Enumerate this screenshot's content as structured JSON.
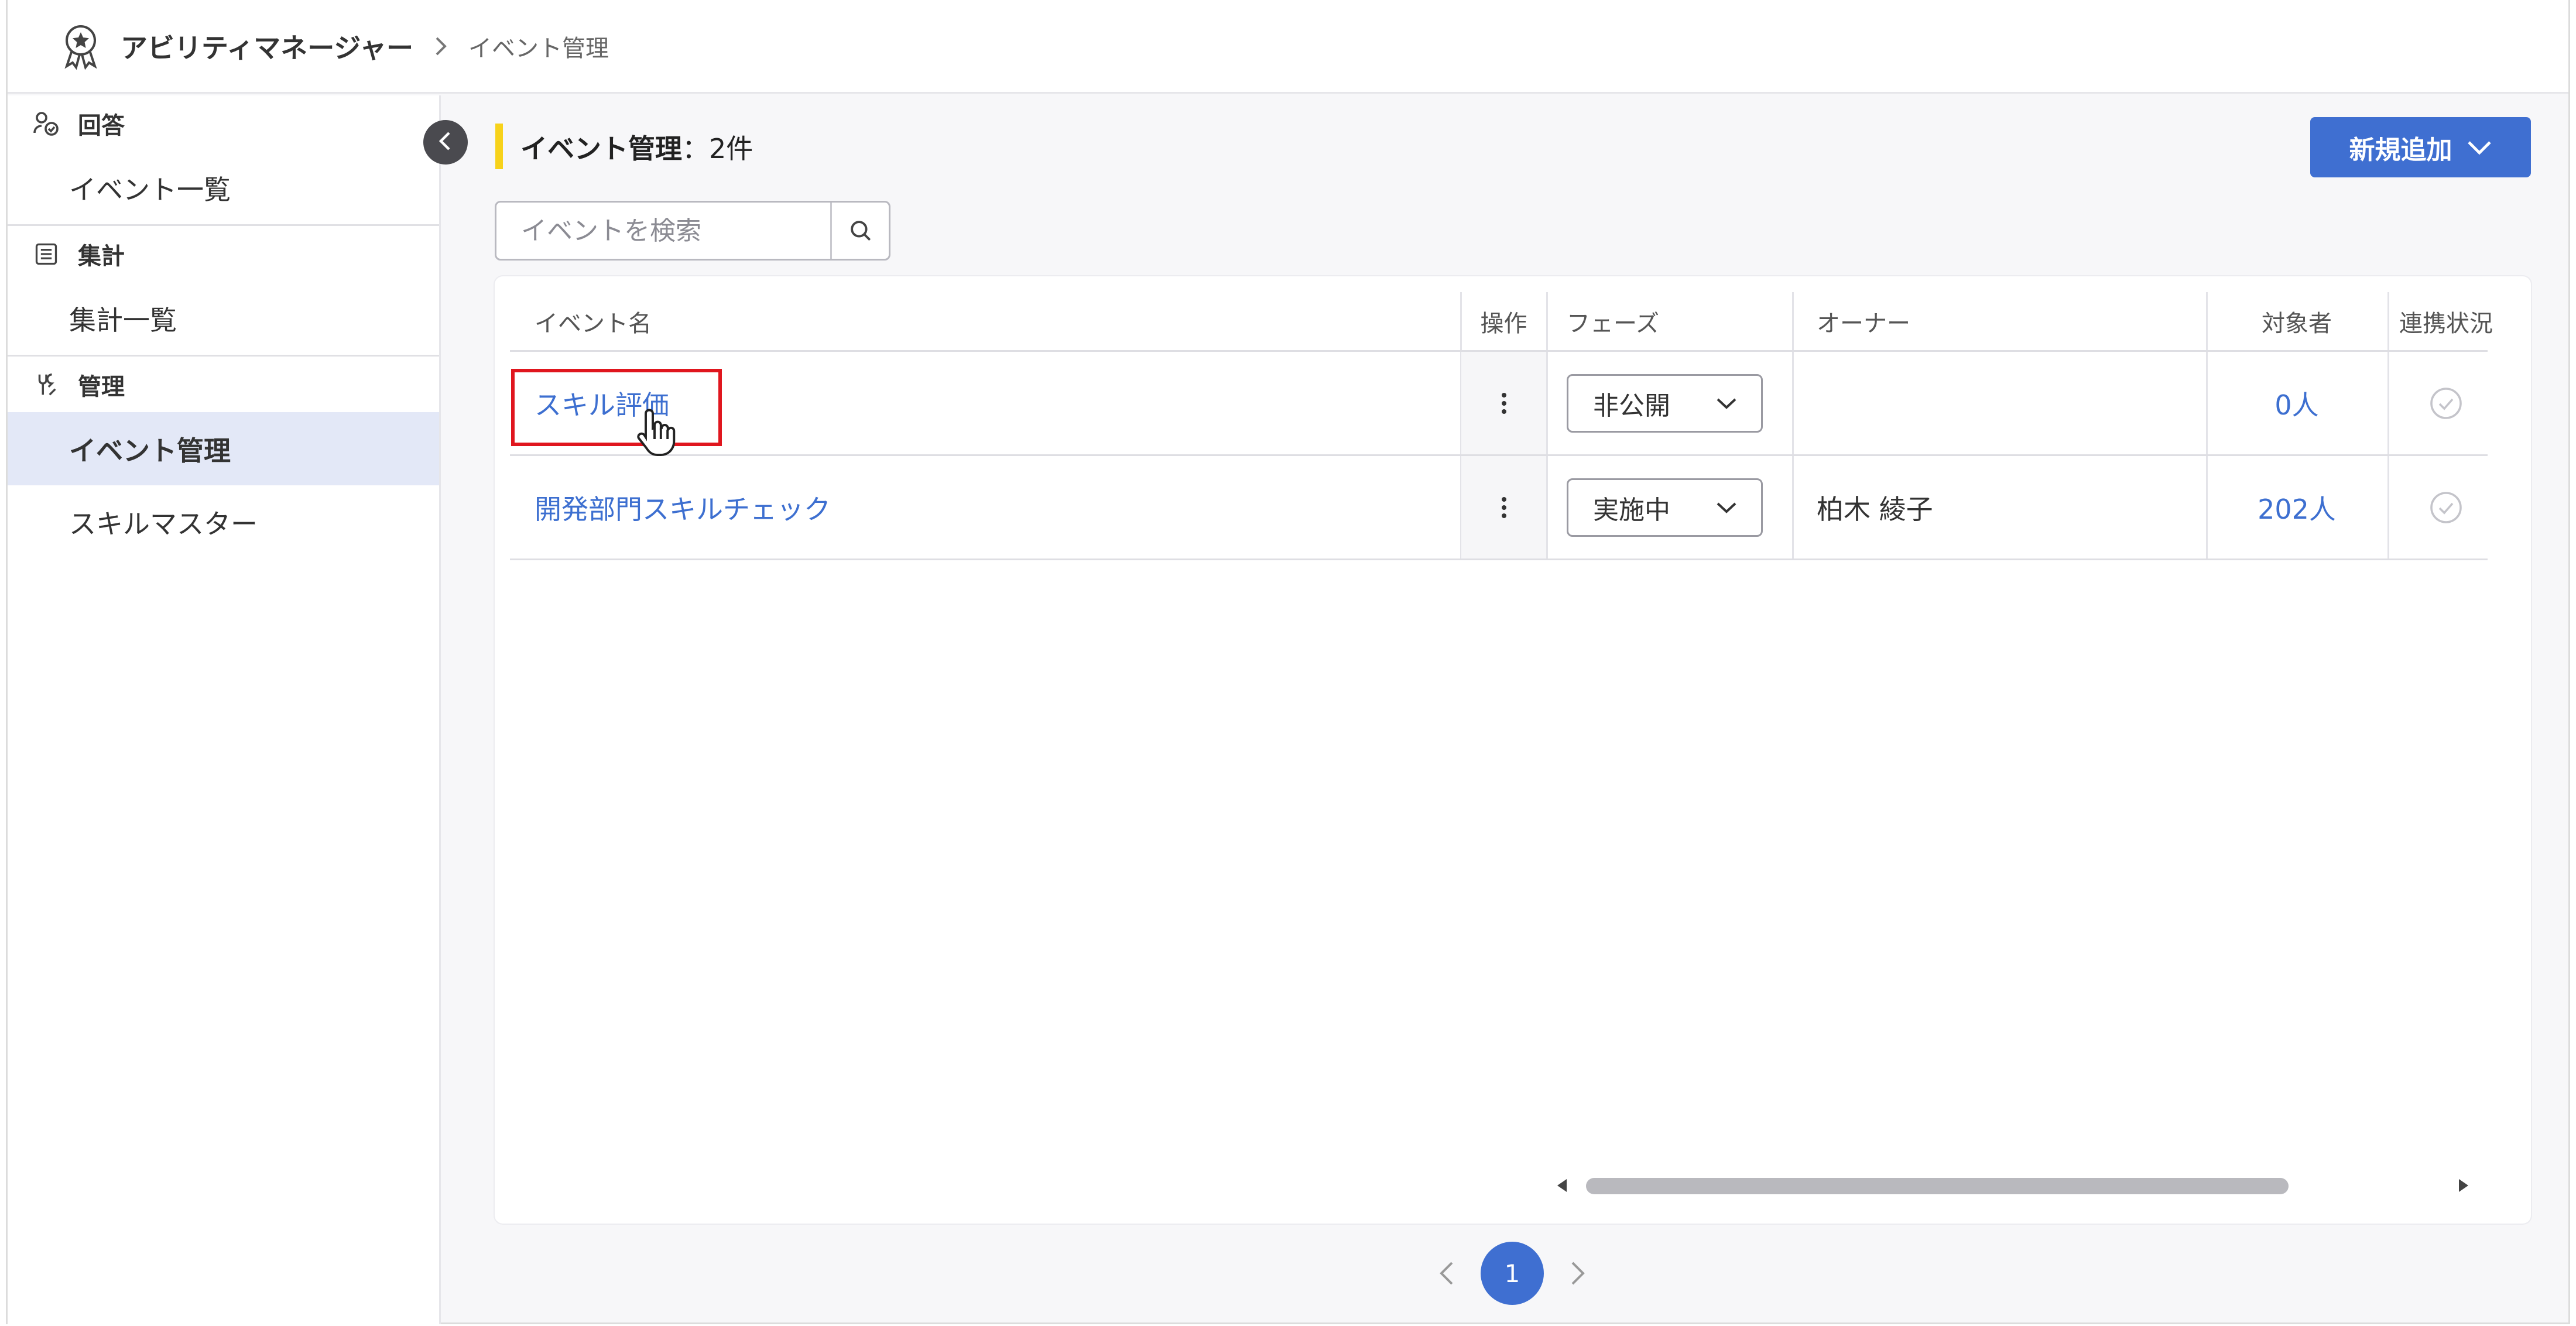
{
  "header": {
    "app_title": "アビリティマネージャー",
    "breadcrumb_current": "イベント管理"
  },
  "sidebar": {
    "sections": [
      {
        "label": "回答",
        "icon": "person-check-icon",
        "items": [
          "イベント一覧"
        ]
      },
      {
        "label": "集計",
        "icon": "list-sheet-icon",
        "items": [
          "集計一覧"
        ]
      },
      {
        "label": "管理",
        "icon": "tools-icon",
        "items": [
          "イベント管理",
          "スキルマスター"
        ]
      }
    ],
    "active_item": "イベント管理"
  },
  "main": {
    "title": "イベント管理",
    "count_text": "：2件",
    "new_button_label": "新規追加",
    "search_placeholder": "イベントを検索"
  },
  "table": {
    "columns": [
      "イベント名",
      "操作",
      "フェーズ",
      "オーナー",
      "対象者",
      "連携状況"
    ],
    "rows": [
      {
        "name": "スキル評価",
        "phase": "非公開",
        "owner": "",
        "target": "0人"
      },
      {
        "name": "開発部門スキルチェック",
        "phase": "実施中",
        "owner": "柏木 綾子",
        "target": "202人"
      }
    ]
  },
  "pagination": {
    "current_page": "1"
  },
  "colors": {
    "accent": "#3f6fd1",
    "title_bar": "#f7d21b",
    "highlight": "#e0161e",
    "active_bg": "#e3e8f7"
  }
}
